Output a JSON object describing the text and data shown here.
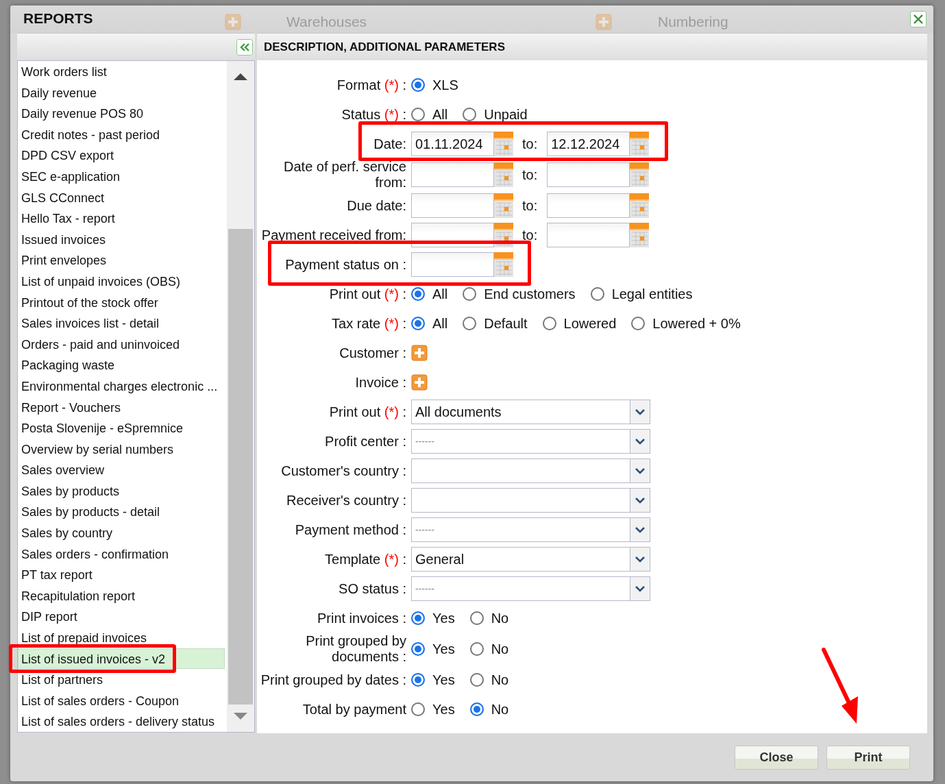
{
  "background": {
    "ghost_tabs": [
      {
        "label": "Warehouses"
      },
      {
        "label": "Numbering"
      }
    ]
  },
  "window": {
    "title": "REPORTS"
  },
  "list_panel": {
    "items": [
      {
        "label": "Work orders list",
        "selected": false
      },
      {
        "label": "Daily revenue",
        "selected": false
      },
      {
        "label": "Daily revenue POS 80",
        "selected": false
      },
      {
        "label": "Credit notes - past period",
        "selected": false
      },
      {
        "label": "DPD CSV export",
        "selected": false
      },
      {
        "label": "SEC e-application",
        "selected": false
      },
      {
        "label": "GLS CConnect",
        "selected": false
      },
      {
        "label": "Hello Tax - report",
        "selected": false
      },
      {
        "label": "Issued invoices",
        "selected": false
      },
      {
        "label": "Print envelopes",
        "selected": false
      },
      {
        "label": "List of unpaid invoices (OBS)",
        "selected": false
      },
      {
        "label": "Printout of the stock offer",
        "selected": false
      },
      {
        "label": "Sales invoices list - detail",
        "selected": false
      },
      {
        "label": "Orders - paid and uninvoiced",
        "selected": false
      },
      {
        "label": "Packaging waste",
        "selected": false
      },
      {
        "label": "Environmental charges electronic ...",
        "selected": false
      },
      {
        "label": "Report - Vouchers",
        "selected": false
      },
      {
        "label": "Posta Slovenije - eSpremnice",
        "selected": false
      },
      {
        "label": "Overview by serial numbers",
        "selected": false
      },
      {
        "label": "Sales overview",
        "selected": false
      },
      {
        "label": "Sales by products",
        "selected": false
      },
      {
        "label": "Sales by products - detail",
        "selected": false
      },
      {
        "label": "Sales by country",
        "selected": false
      },
      {
        "label": "Sales orders - confirmation",
        "selected": false
      },
      {
        "label": "PT tax report",
        "selected": false
      },
      {
        "label": "Recapitulation report",
        "selected": false
      },
      {
        "label": "DIP report",
        "selected": false
      },
      {
        "label": "List of prepaid invoices",
        "selected": false
      },
      {
        "label": "List of issued invoices - v2",
        "selected": true,
        "highlighted": true
      },
      {
        "label": "List of partners",
        "selected": false
      },
      {
        "label": "List of sales orders - Coupon",
        "selected": false
      },
      {
        "label": "List of sales orders - delivery status",
        "selected": false
      }
    ]
  },
  "form_panel": {
    "title": "DESCRIPTION, ADDITIONAL PARAMETERS",
    "rows": [
      {
        "kind": "radio",
        "label": "Format",
        "required": "(*)",
        "colon": ":",
        "options": [
          {
            "label": "XLS",
            "selected": true
          }
        ]
      },
      {
        "kind": "radio",
        "label": "Status",
        "required": "(*)",
        "colon": ":",
        "options": [
          {
            "label": "All",
            "selected": false
          },
          {
            "label": "Unpaid",
            "selected": false
          }
        ]
      },
      {
        "kind": "daterange",
        "label": "Date:",
        "from": "01.11.2024",
        "to_label": "to:",
        "to": "12.12.2024",
        "highlighted": true
      },
      {
        "kind": "daterange",
        "label": "Date of perf. service from:",
        "to_label": "to:"
      },
      {
        "kind": "daterange",
        "label": "Due date:",
        "to_label": "to:"
      },
      {
        "kind": "daterange",
        "label": "Payment received from:",
        "to_label": "to:"
      },
      {
        "kind": "date",
        "label": "Payment status on :",
        "highlighted": true
      },
      {
        "kind": "radio",
        "label": "Print out",
        "required": "(*)",
        "colon": ":",
        "options": [
          {
            "label": "All",
            "selected": true
          },
          {
            "label": "End customers",
            "selected": false
          },
          {
            "label": "Legal entities",
            "selected": false
          }
        ]
      },
      {
        "kind": "radio",
        "label": "Tax rate",
        "required": "(*)",
        "colon": ":",
        "options": [
          {
            "label": "All",
            "selected": true
          },
          {
            "label": "Default",
            "selected": false
          },
          {
            "label": "Lowered",
            "selected": false
          },
          {
            "label": "Lowered + 0%",
            "selected": false
          }
        ]
      },
      {
        "kind": "add",
        "label": "Customer :"
      },
      {
        "kind": "add",
        "label": "Invoice :"
      },
      {
        "kind": "select",
        "label": "Print out",
        "required": "(*)",
        "colon": ":",
        "value": "All documents"
      },
      {
        "kind": "select",
        "label": "Profit center :",
        "placeholder": "------"
      },
      {
        "kind": "select",
        "label": "Customer's country :"
      },
      {
        "kind": "select",
        "label": "Receiver's country :"
      },
      {
        "kind": "select",
        "label": "Payment method :",
        "placeholder": "------"
      },
      {
        "kind": "select",
        "label": "Template",
        "required": "(*)",
        "colon": ":",
        "value": "General"
      },
      {
        "kind": "select",
        "label": "SO status :",
        "placeholder": "------"
      },
      {
        "kind": "radio",
        "label": "Print invoices :",
        "options": [
          {
            "label": "Yes",
            "selected": true
          },
          {
            "label": "No",
            "selected": false
          }
        ]
      },
      {
        "kind": "radio",
        "label": "Print grouped by documents :",
        "options": [
          {
            "label": "Yes",
            "selected": true
          },
          {
            "label": "No",
            "selected": false
          }
        ]
      },
      {
        "kind": "radio",
        "label": "Print grouped by dates :",
        "options": [
          {
            "label": "Yes",
            "selected": true
          },
          {
            "label": "No",
            "selected": false
          }
        ]
      },
      {
        "kind": "radio",
        "label": "Total by payment",
        "options": [
          {
            "label": "Yes",
            "selected": false
          },
          {
            "label": "No",
            "selected": true
          }
        ]
      }
    ]
  },
  "buttons": [
    {
      "label": "Close",
      "pointed": false
    },
    {
      "label": "Print",
      "pointed": true
    }
  ]
}
